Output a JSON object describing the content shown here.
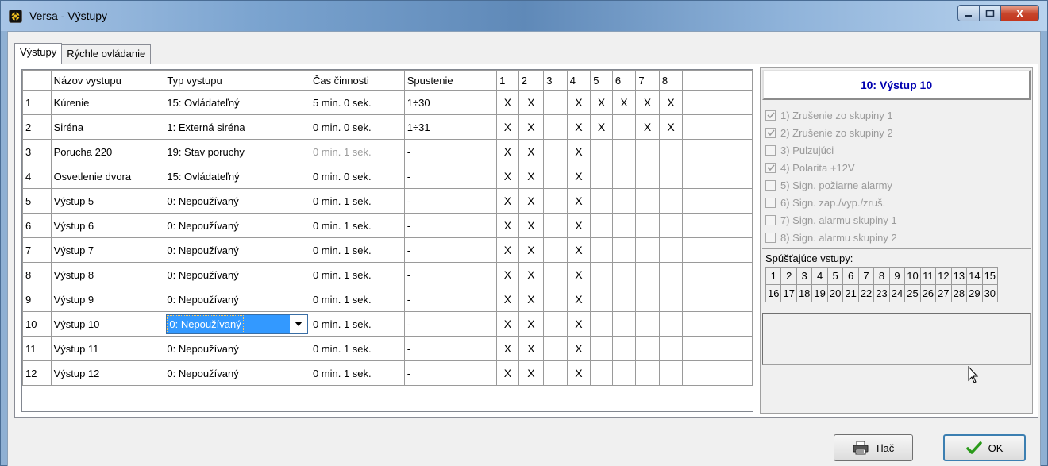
{
  "window": {
    "title": "Versa - Výstupy",
    "close_glyph": "X"
  },
  "tabs": [
    {
      "label": "Výstupy"
    },
    {
      "label": "Rýchle ovládanie"
    }
  ],
  "grid": {
    "headers": [
      "",
      "Názov vystupu",
      "Typ vystupu",
      "Čas činnosti",
      "Spustenie",
      "1",
      "2",
      "3",
      "4",
      "5",
      "6",
      "7",
      "8",
      ""
    ],
    "rows": [
      {
        "num": "1",
        "name": "Kúrenie",
        "type": "15: Ovládateľný",
        "time": "5 min. 0 sek.",
        "trigger": "1÷30",
        "flags": [
          "X",
          "X",
          "",
          "X",
          "X",
          "X",
          "X",
          "X"
        ]
      },
      {
        "num": "2",
        "name": "Siréna",
        "type": "1: Externá siréna",
        "time": "0 min. 0 sek.",
        "trigger": "1÷31",
        "flags": [
          "X",
          "X",
          "",
          "X",
          "X",
          "",
          "X",
          "X"
        ]
      },
      {
        "num": "3",
        "name": "Porucha 220",
        "type": "19: Stav poruchy",
        "time": "0 min. 1 sek.",
        "trigger": "-",
        "flags": [
          "X",
          "X",
          "",
          "X",
          "",
          "",
          "",
          ""
        ]
      },
      {
        "num": "4",
        "name": "Osvetlenie dvora",
        "type": "15: Ovládateľný",
        "time": "0 min. 0 sek.",
        "trigger": "-",
        "flags": [
          "X",
          "X",
          "",
          "X",
          "",
          "",
          "",
          ""
        ]
      },
      {
        "num": "5",
        "name": "Výstup  5",
        "type": "0: Nepoužívaný",
        "time": "0 min. 1 sek.",
        "trigger": "-",
        "flags": [
          "X",
          "X",
          "",
          "X",
          "",
          "",
          "",
          ""
        ]
      },
      {
        "num": "6",
        "name": "Výstup  6",
        "type": "0: Nepoužívaný",
        "time": "0 min. 1 sek.",
        "trigger": "-",
        "flags": [
          "X",
          "X",
          "",
          "X",
          "",
          "",
          "",
          ""
        ]
      },
      {
        "num": "7",
        "name": "Výstup  7",
        "type": "0: Nepoužívaný",
        "time": "0 min. 1 sek.",
        "trigger": "-",
        "flags": [
          "X",
          "X",
          "",
          "X",
          "",
          "",
          "",
          ""
        ]
      },
      {
        "num": "8",
        "name": "Výstup  8",
        "type": "0: Nepoužívaný",
        "time": "0 min. 1 sek.",
        "trigger": "-",
        "flags": [
          "X",
          "X",
          "",
          "X",
          "",
          "",
          "",
          ""
        ]
      },
      {
        "num": "9",
        "name": "Výstup  9",
        "type": "0: Nepoužívaný",
        "time": "0 min. 1 sek.",
        "trigger": "-",
        "flags": [
          "X",
          "X",
          "",
          "X",
          "",
          "",
          "",
          ""
        ]
      },
      {
        "num": "10",
        "name": "Výstup 10",
        "type": "0: Nepoužívaný",
        "time": "0 min. 1 sek.",
        "trigger": "-",
        "flags": [
          "X",
          "X",
          "",
          "X",
          "",
          "",
          "",
          ""
        ],
        "selected": true
      },
      {
        "num": "11",
        "name": "Výstup 11",
        "type": "0: Nepoužívaný",
        "time": "0 min. 1 sek.",
        "trigger": "-",
        "flags": [
          "X",
          "X",
          "",
          "X",
          "",
          "",
          "",
          ""
        ]
      },
      {
        "num": "12",
        "name": "Výstup 12",
        "type": "0: Nepoužívaný",
        "time": "0 min. 1 sek.",
        "trigger": "-",
        "flags": [
          "X",
          "X",
          "",
          "X",
          "",
          "",
          "",
          ""
        ]
      }
    ]
  },
  "side": {
    "header": "10: Výstup 10",
    "options": [
      {
        "label": "1) Zrušenie zo skupiny 1",
        "checked": true
      },
      {
        "label": "2) Zrušenie zo skupiny 2",
        "checked": true
      },
      {
        "label": "3) Pulzujúci",
        "checked": false
      },
      {
        "label": "4) Polarita +12V",
        "checked": true
      },
      {
        "label": "5) Sign. požiarne alarmy",
        "checked": false
      },
      {
        "label": "6) Sign. zap./vyp./zruš.",
        "checked": false
      },
      {
        "label": "7) Sign. alarmu skupiny 1",
        "checked": false
      },
      {
        "label": "8) Sign. alarmu skupiny 2",
        "checked": false
      }
    ],
    "trigger_label": "Spúšťajúce vstupy:",
    "trigger_rows": [
      [
        "1",
        "2",
        "3",
        "4",
        "5",
        "6",
        "7",
        "8",
        "9",
        "10",
        "11",
        "12",
        "13",
        "14",
        "15"
      ],
      [
        "16",
        "17",
        "18",
        "19",
        "20",
        "21",
        "22",
        "23",
        "24",
        "25",
        "26",
        "27",
        "28",
        "29",
        "30"
      ]
    ]
  },
  "buttons": {
    "print": "Tlač",
    "ok": "OK"
  }
}
